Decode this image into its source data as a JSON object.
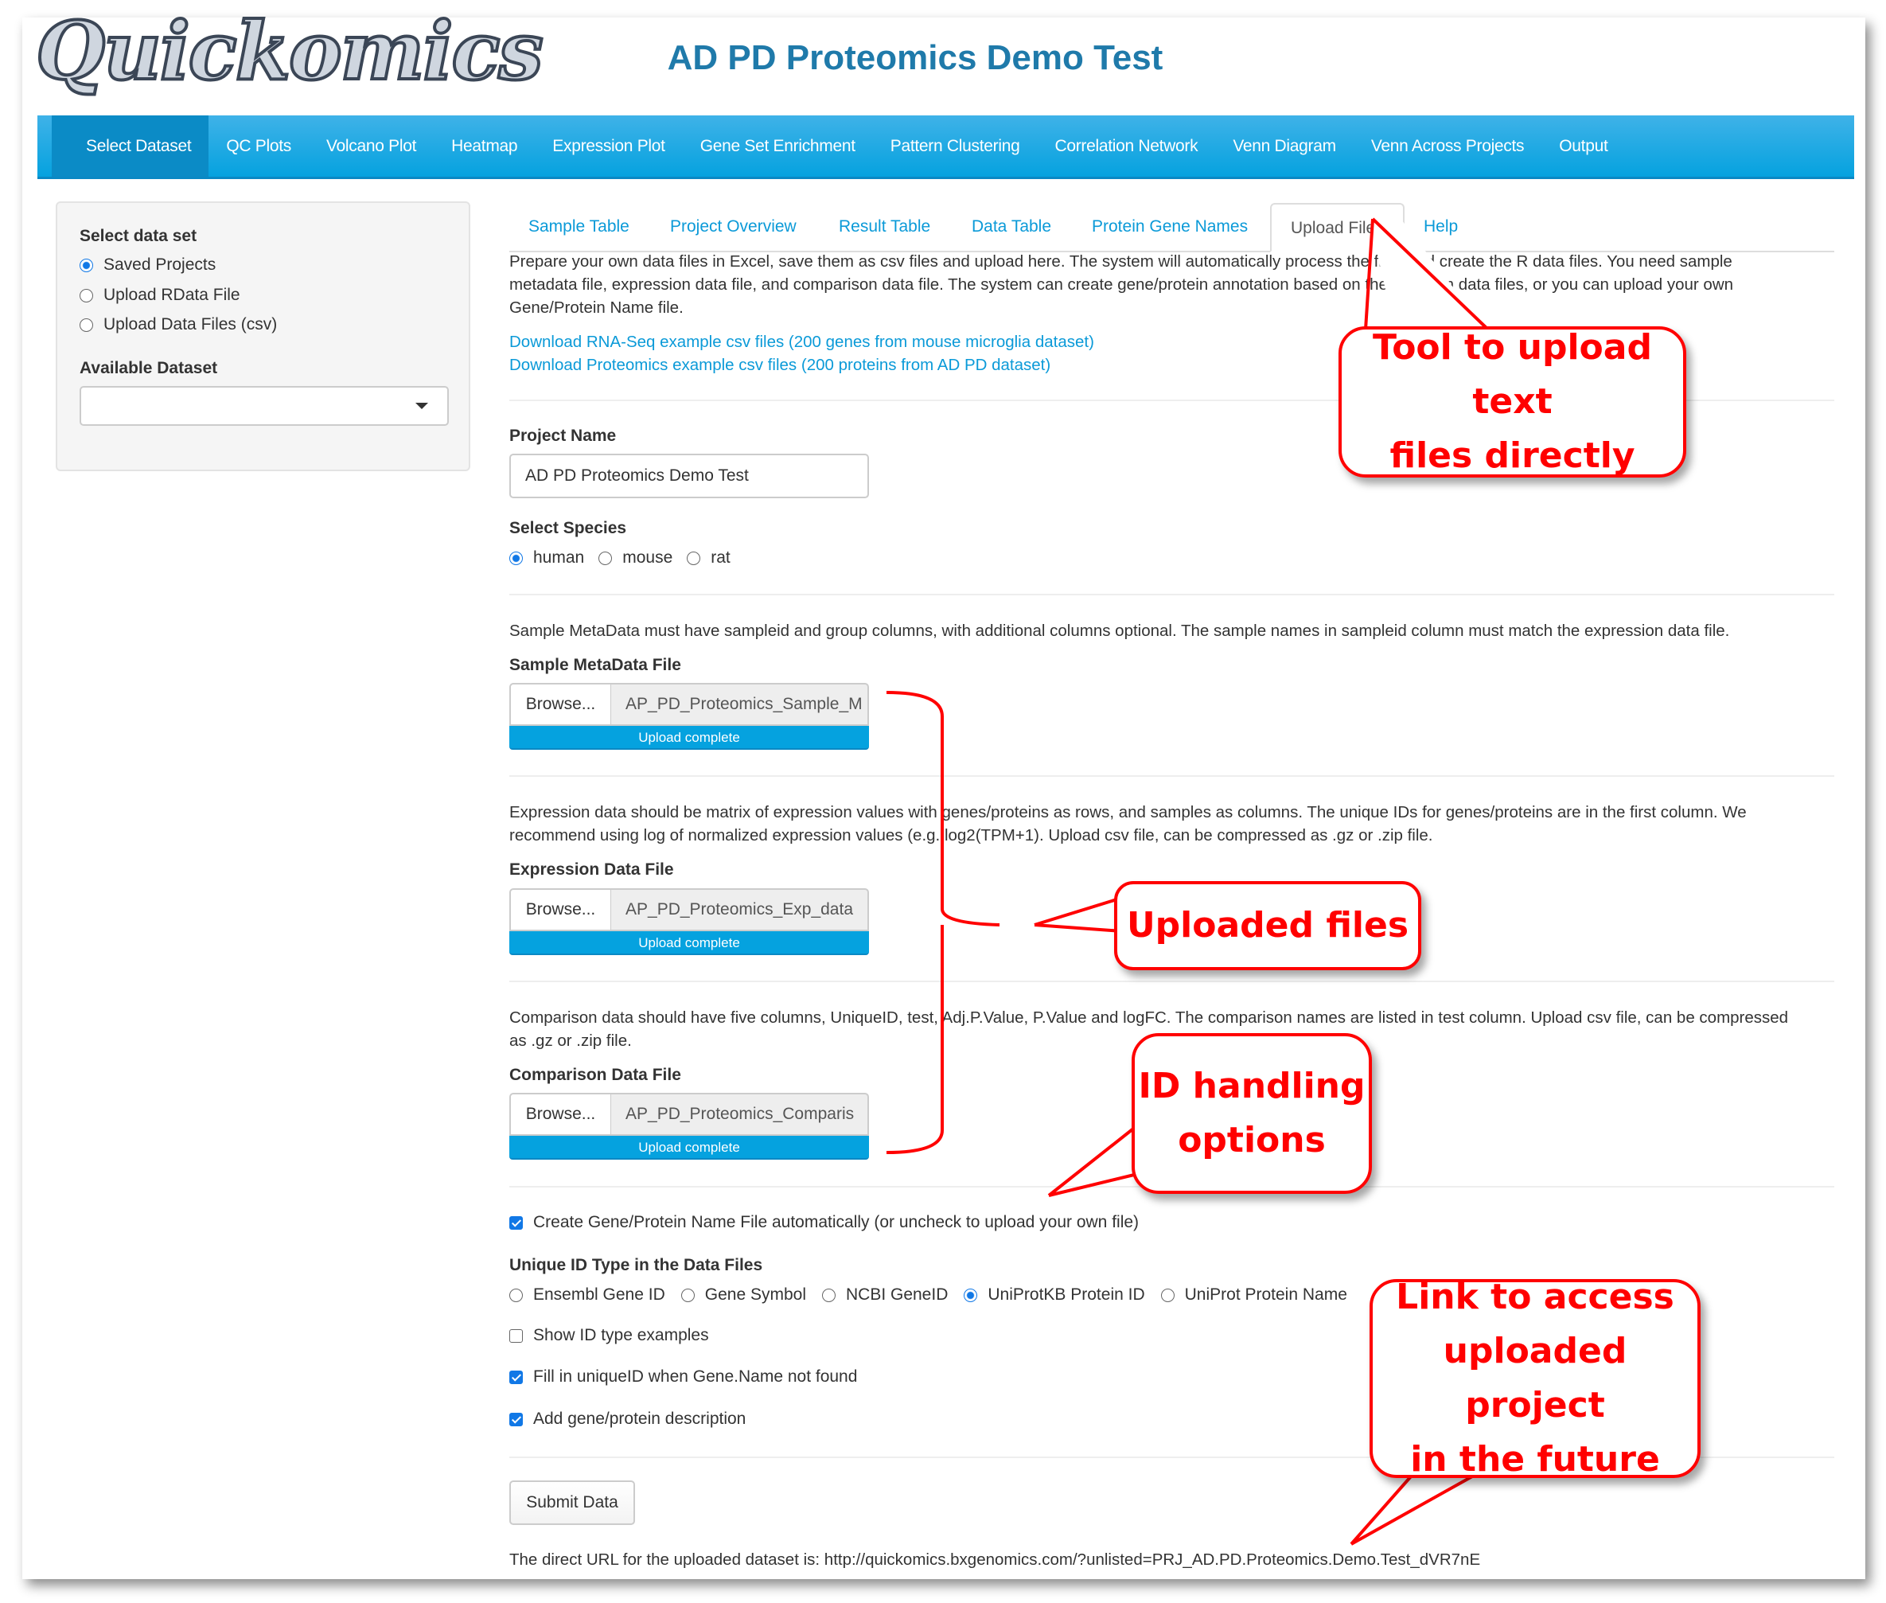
{
  "app": {
    "logo_text": "Quickomics",
    "title": "AD PD Proteomics Demo Test"
  },
  "navbar": {
    "items": [
      {
        "label": "Select Dataset",
        "active": true
      },
      {
        "label": "QC Plots"
      },
      {
        "label": "Volcano Plot"
      },
      {
        "label": "Heatmap"
      },
      {
        "label": "Expression Plot"
      },
      {
        "label": "Gene Set Enrichment"
      },
      {
        "label": "Pattern Clustering"
      },
      {
        "label": "Correlation Network"
      },
      {
        "label": "Venn Diagram"
      },
      {
        "label": "Venn Across Projects"
      },
      {
        "label": "Output"
      }
    ]
  },
  "sidebar": {
    "select_label": "Select data set",
    "options": [
      {
        "label": "Saved Projects",
        "selected": true
      },
      {
        "label": "Upload RData File",
        "selected": false
      },
      {
        "label": "Upload Data Files (csv)",
        "selected": false
      }
    ],
    "available_label": "Available Dataset",
    "available_value": ""
  },
  "tabs": [
    {
      "label": "Sample Table"
    },
    {
      "label": "Project Overview"
    },
    {
      "label": "Result Table"
    },
    {
      "label": "Data Table"
    },
    {
      "label": "Protein Gene Names"
    },
    {
      "label": "Upload Files",
      "active": true
    },
    {
      "label": "Help"
    }
  ],
  "upload": {
    "intro_lines": [
      "Prepare your own data files in Excel, save them as csv files and upload here. The system will automatically process the files and create the R data files. You need sample",
      "metadata file, expression data file, and comparison data file. The system can create gene/protein annotation based on the IDs from data files, or you can upload your own",
      "Gene/Protein Name file."
    ],
    "links": [
      "Download RNA-Seq example csv files (200 genes from mouse microglia dataset)",
      "Download Proteomics example csv files (200 proteins from AD PD dataset)"
    ],
    "project_name_label": "Project Name",
    "project_name_value": "AD PD Proteomics Demo Test",
    "species_label": "Select Species",
    "species": [
      {
        "label": "human",
        "selected": true
      },
      {
        "label": "mouse",
        "selected": false
      },
      {
        "label": "rat",
        "selected": false
      }
    ],
    "metadata_help": "Sample MetaData must have sampleid and group columns, with additional columns optional. The sample names in sampleid column must match the expression data file.",
    "metadata_label": "Sample MetaData File",
    "metadata_file": "AP_PD_Proteomics_Sample_M",
    "expression_help_lines": [
      "Expression data should be matrix of expression values with genes/proteins as rows, and samples as columns. The unique IDs for genes/proteins are in the first column. We",
      "recommend using log of normalized expression values (e.g. log2(TPM+1). Upload csv file, can be compressed as .gz or .zip file."
    ],
    "expression_label": "Expression Data File",
    "expression_file": "AP_PD_Proteomics_Exp_data",
    "comparison_help_lines": [
      "Comparison data should have five columns, UniqueID, test, Adj.P.Value, P.Value and logFC. The comparison names are listed in test column. Upload csv file, can be compressed",
      "as .gz or .zip file."
    ],
    "comparison_label": "Comparison Data File",
    "comparison_file": "AP_PD_Proteomics_Comparis",
    "browse_label": "Browse...",
    "upload_status": "Upload complete",
    "upload_progress_percent": 100,
    "auto_name_label": "Create Gene/Protein Name File automatically (or uncheck to upload your own file)",
    "auto_name_checked": true,
    "id_type_label": "Unique ID Type in the Data Files",
    "id_types": [
      {
        "label": "Ensembl Gene ID",
        "selected": false
      },
      {
        "label": "Gene Symbol",
        "selected": false
      },
      {
        "label": "NCBI GeneID",
        "selected": false
      },
      {
        "label": "UniProtKB Protein ID",
        "selected": true
      },
      {
        "label": "UniProt Protein Name",
        "selected": false
      }
    ],
    "show_examples_label": "Show ID type examples",
    "show_examples_checked": false,
    "fill_unique_label": "Fill in uniqueID when Gene.Name not found",
    "fill_unique_checked": true,
    "add_desc_label": "Add gene/protein description",
    "add_desc_checked": true,
    "submit_label": "Submit Data",
    "direct_url_text": "The direct URL for the uploaded dataset is: http://quickomics.bxgenomics.com/?unlisted=PRJ_AD.PD.Proteomics.Demo.Test_dVR7nE"
  },
  "annotations": {
    "upload_tool": [
      "Tool to upload text",
      "files directly"
    ],
    "uploaded_files": [
      "Uploaded files"
    ],
    "id_handling": [
      "ID handling",
      "options"
    ],
    "future_link": [
      "Link to access",
      "uploaded project",
      "in the future"
    ],
    "color": "#ff0000"
  }
}
